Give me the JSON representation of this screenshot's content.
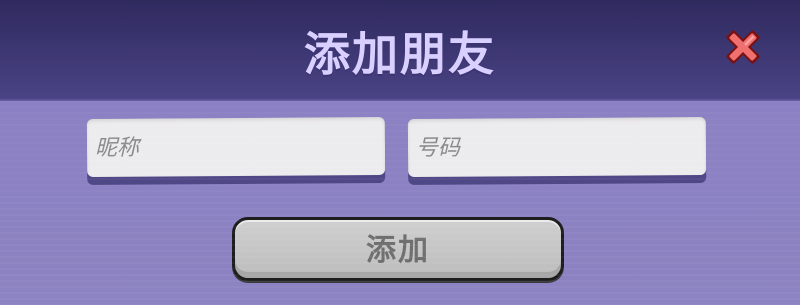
{
  "dialog": {
    "title": "添加朋友",
    "close_icon": "close-x-icon"
  },
  "form": {
    "nickname_placeholder": "昵称",
    "number_placeholder": "号码",
    "nickname_value": "",
    "number_value": ""
  },
  "actions": {
    "add_label": "添加"
  },
  "colors": {
    "header": "#3b3570",
    "body": "#8a80c4",
    "title": "#d9d0ff",
    "close": "#f06060",
    "input_bg": "#ecebed",
    "button_bg": "#c4c4c4"
  }
}
